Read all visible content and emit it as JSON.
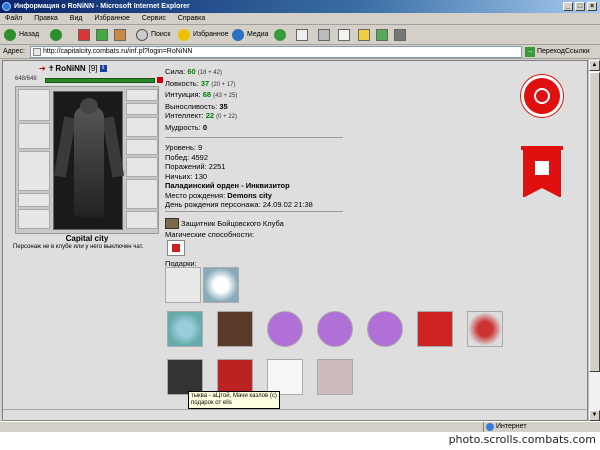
{
  "window": {
    "title": "Информация о RoNiNN - Microsoft Internet Explorer"
  },
  "menu": [
    "Файл",
    "Правка",
    "Вид",
    "Избранное",
    "Сервис",
    "Справка"
  ],
  "toolbar": {
    "back": "Назад",
    "search": "Поиск",
    "favorites": "Избранное",
    "media": "Медиа"
  },
  "address": {
    "label": "Адрес:",
    "url": "http://capitalcity.combats.ru/inf.pl?login=RoNiNN",
    "go": "Переход",
    "links": "Ссылки"
  },
  "character": {
    "name": "RoNiNN",
    "level": "[9]",
    "badge": "i",
    "hp": "648/648",
    "hp_fraction": 1.0,
    "city": "Capital city",
    "note": "Персонаж не в клубе или у него выключен чат."
  },
  "stats": [
    {
      "label": "Сила:",
      "value": "60",
      "bonus": "(18 + 42)"
    },
    {
      "label": "Ловкость:",
      "value": "37",
      "bonus": "(20 + 17)"
    },
    {
      "label": "Интуиция:",
      "value": "68",
      "bonus": "(43 + 25)"
    },
    {
      "label": "Выносливость:",
      "value": "35",
      "bonus": ""
    },
    {
      "label": "Интеллект:",
      "value": "22",
      "bonus": "(0 + 22)"
    },
    {
      "label": "Мудрость:",
      "value": "0",
      "bonus": ""
    }
  ],
  "info": {
    "level": "Уровень: 9",
    "wins": "Побед: 4592",
    "losses": "Поражений: 2251",
    "draws": "Ничьих: 130",
    "order": "Паладинский орден - Инквизитор",
    "birthplace_label": "Место рождения:",
    "birthplace": "Demons city",
    "birthday": "День рождения персонажа: 24.09.02 21:38"
  },
  "club": "Защитник Бойцовского Клуба",
  "magic_label": "Магические способности:",
  "gifts_label": "Подарки:",
  "tooltip": {
    "line1": "тыква - аЦтой, Мачи казлов (c)",
    "line2": "подарок от elis"
  },
  "status": {
    "left": "",
    "zone": "Интернет"
  },
  "watermark": "photo.scrolls.combats.com",
  "colors": {
    "stat_value": "#008000",
    "emblem": "#e01010",
    "gift_purple": "#b070d8"
  }
}
